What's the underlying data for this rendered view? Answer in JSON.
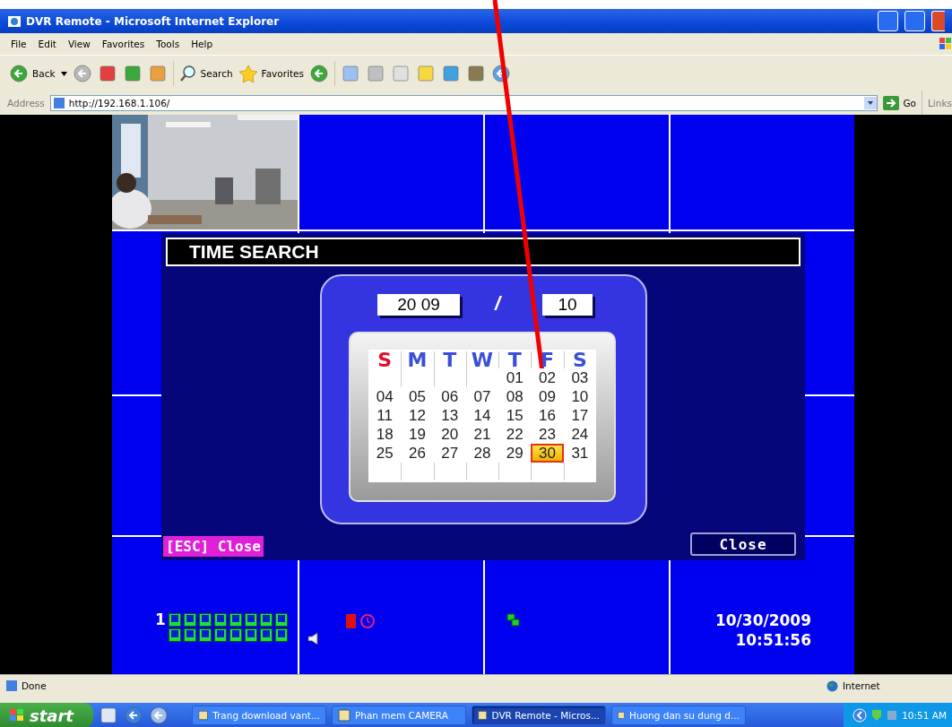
{
  "window": {
    "title": "DVR Remote - Microsoft Internet Explorer"
  },
  "menu": [
    "File",
    "Edit",
    "View",
    "Favorites",
    "Tools",
    "Help"
  ],
  "toolbar": {
    "back": "Back",
    "search": "Search",
    "favorites": "Favorites"
  },
  "address_bar": {
    "label": "Address",
    "url": "http://192.168.1.106/",
    "go": "Go",
    "links": "Links"
  },
  "dvr": {
    "dialog": {
      "title": "TIME SEARCH",
      "year": "20 09",
      "separator": "/",
      "month": "10",
      "weekdays": [
        {
          "label": "S",
          "color": "#e0102a"
        },
        {
          "label": "M",
          "color": "#3a4fd8"
        },
        {
          "label": "T",
          "color": "#3a4fd8"
        },
        {
          "label": "W",
          "color": "#3a4fd8"
        },
        {
          "label": "T",
          "color": "#3a4fd8"
        },
        {
          "label": "F",
          "color": "#3a4fd8"
        },
        {
          "label": "S",
          "color": "#3a4fd8"
        }
      ],
      "weeks": [
        [
          {
            "label": "01",
            "selected": false
          },
          {
            "label": "02",
            "selected": false
          },
          {
            "label": "03",
            "selected": false
          }
        ],
        [
          {
            "label": "04",
            "selected": false
          },
          {
            "label": "05",
            "selected": false
          },
          {
            "label": "06",
            "selected": false
          },
          {
            "label": "07",
            "selected": false
          },
          {
            "label": "08",
            "selected": false
          },
          {
            "label": "09",
            "selected": false
          },
          {
            "label": "10",
            "selected": false
          }
        ],
        [
          {
            "label": "11",
            "selected": false
          },
          {
            "label": "12",
            "selected": false
          },
          {
            "label": "13",
            "selected": false
          },
          {
            "label": "14",
            "selected": false
          },
          {
            "label": "15",
            "selected": false
          },
          {
            "label": "16",
            "selected": false
          },
          {
            "label": "17",
            "selected": false
          }
        ],
        [
          {
            "label": "18",
            "selected": false
          },
          {
            "label": "19",
            "selected": false
          },
          {
            "label": "20",
            "selected": false
          },
          {
            "label": "21",
            "selected": false
          },
          {
            "label": "22",
            "selected": false
          },
          {
            "label": "23",
            "selected": false
          },
          {
            "label": "24",
            "selected": false
          }
        ],
        [
          {
            "label": "25",
            "selected": false
          },
          {
            "label": "26",
            "selected": false
          },
          {
            "label": "27",
            "selected": false
          },
          {
            "label": "28",
            "selected": false
          },
          {
            "label": "29",
            "selected": false
          },
          {
            "label": "30",
            "selected": true
          },
          {
            "label": "31",
            "selected": false
          }
        ]
      ],
      "esc_hint": "[ESC] Close",
      "close_button": "Close"
    },
    "channel_label": "1",
    "date": "10/30/2009",
    "time": "10:51:56"
  },
  "status_bar": {
    "text": "Done",
    "zone": "Internet"
  },
  "taskbar": {
    "start": "start",
    "tasks": [
      {
        "label": "Trang download vant...",
        "selected": false
      },
      {
        "label": "Phan mem CAMERA",
        "selected": false
      },
      {
        "label": "DVR Remote - Micros...",
        "selected": true
      },
      {
        "label": "Huong dan su dung d...",
        "selected": false
      }
    ],
    "clock": "10:51 AM"
  }
}
